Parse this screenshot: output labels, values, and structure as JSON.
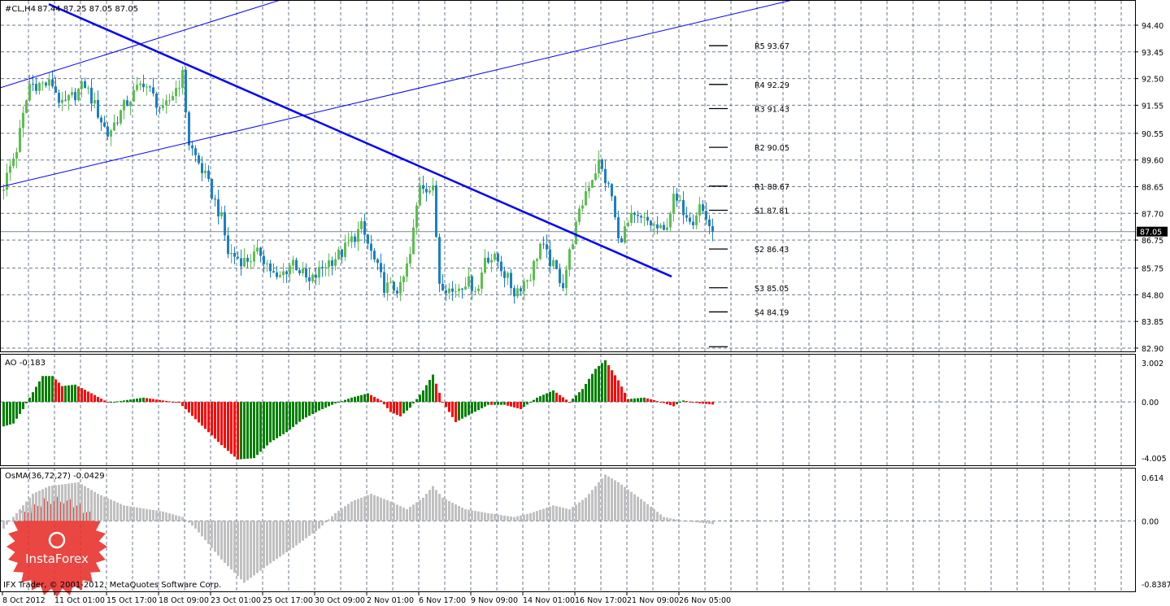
{
  "header": {
    "symbol_label": "#CL,H4",
    "ohlc_label": "87.44 87.25 87.05 87.05"
  },
  "footer": {
    "copyright": "IFX Trader, © 2001-2012, MetaQuotes Software Corp."
  },
  "logo": {
    "text": "InstaForex"
  },
  "colors": {
    "bull": "#5bbf4e",
    "bear": "#1a7fc8",
    "trendline": "#0000ff",
    "ao_up": "#008000",
    "ao_down": "#ff0000",
    "osma": "#c0c0c0",
    "grid": "#6b7a8c"
  },
  "chart_data": [
    {
      "type": "candlestick",
      "title": "#CL,H4",
      "ylim": [
        82.9,
        94.75
      ],
      "y_ticks": [
        "94.40",
        "93.45",
        "92.50",
        "91.55",
        "90.55",
        "89.60",
        "88.65",
        "87.70",
        "86.75",
        "85.75",
        "84.80",
        "83.85",
        "82.90"
      ],
      "current_price": "87.05",
      "bar_count": 219,
      "x_ticks": [
        {
          "bar": 0,
          "label": "8 Oct 2012"
        },
        {
          "bar": 16,
          "label": "11 Oct 01:00"
        },
        {
          "bar": 32,
          "label": "15 Oct 17:00"
        },
        {
          "bar": 48,
          "label": "18 Oct 09:00"
        },
        {
          "bar": 64,
          "label": "23 Oct 01:00"
        },
        {
          "bar": 80,
          "label": "25 Oct 17:00"
        },
        {
          "bar": 96,
          "label": "30 Oct 09:00"
        },
        {
          "bar": 112,
          "label": "2 Nov 01:00"
        },
        {
          "bar": 128,
          "label": "6 Nov 17:00"
        },
        {
          "bar": 144,
          "label": "9 Nov 09:00"
        },
        {
          "bar": 160,
          "label": "14 Nov 01:00"
        },
        {
          "bar": 176,
          "label": "16 Nov 17:00"
        },
        {
          "bar": 192,
          "label": "21 Nov 09:00"
        },
        {
          "bar": 208,
          "label": "26 Nov 05:00"
        }
      ],
      "close_path": [
        [
          0,
          88.7
        ],
        [
          4,
          90.0
        ],
        [
          8,
          92.3
        ],
        [
          15,
          92.3
        ],
        [
          18,
          91.5
        ],
        [
          25,
          92.3
        ],
        [
          32,
          90.5
        ],
        [
          37,
          91.5
        ],
        [
          43,
          92.4
        ],
        [
          49,
          91.3
        ],
        [
          55,
          92.6
        ],
        [
          57,
          90.2
        ],
        [
          62,
          89.0
        ],
        [
          67,
          87.5
        ],
        [
          69,
          86.3
        ],
        [
          74,
          86.0
        ],
        [
          79,
          86.3
        ],
        [
          84,
          85.3
        ],
        [
          89,
          86.0
        ],
        [
          94,
          85.2
        ],
        [
          99,
          85.9
        ],
        [
          104,
          86.3
        ],
        [
          110,
          87.2
        ],
        [
          117,
          85.1
        ],
        [
          122,
          85.0
        ],
        [
          125,
          86.2
        ],
        [
          128,
          88.8
        ],
        [
          132,
          88.5
        ],
        [
          134,
          85.3
        ],
        [
          138,
          84.9
        ],
        [
          142,
          85.3
        ],
        [
          146,
          85.0
        ],
        [
          148,
          86.2
        ],
        [
          152,
          86.0
        ],
        [
          157,
          84.9
        ],
        [
          162,
          85.5
        ],
        [
          165,
          86.6
        ],
        [
          172,
          85.2
        ],
        [
          175,
          86.8
        ],
        [
          179,
          88.5
        ],
        [
          183,
          89.5
        ],
        [
          187,
          88.3
        ],
        [
          189,
          86.7
        ],
        [
          193,
          87.5
        ],
        [
          198,
          87.4
        ],
        [
          203,
          87.0
        ],
        [
          206,
          88.2
        ],
        [
          212,
          87.5
        ],
        [
          214,
          88.0
        ],
        [
          218,
          87.05
        ]
      ],
      "trendlines": [
        {
          "name": "downtrend",
          "from": [
            14.25,
            95.15
          ],
          "to": [
            205.75,
            85.45
          ],
          "thick": true
        },
        {
          "name": "channel-upper",
          "from": [
            -0.75,
            92.17
          ],
          "to": [
            85.5,
            95.3
          ],
          "thick": false
        },
        {
          "name": "channel-lower",
          "from": [
            -0.75,
            88.64
          ],
          "to": [
            243,
            95.3
          ],
          "thick": false
        }
      ],
      "pivots": [
        {
          "label": "R5 93.67",
          "value": 93.67
        },
        {
          "label": "R4 92.29",
          "value": 92.29
        },
        {
          "label": "R3 91.43",
          "value": 91.43
        },
        {
          "label": "R2 90.05",
          "value": 90.05
        },
        {
          "label": "R1 88.67",
          "value": 88.67
        },
        {
          "label": "S1 87.81",
          "value": 87.81
        },
        {
          "label": "S2 86.43",
          "value": 86.43
        },
        {
          "label": "S3 85.05",
          "value": 85.05
        },
        {
          "label": "S4 84.19",
          "value": 84.19
        },
        {
          "label": "",
          "value": 82.95
        }
      ]
    },
    {
      "type": "bar",
      "title": "AO -0.183",
      "ylim": [
        -4.005,
        3.002
      ],
      "y_ticks": [
        "3.002",
        "0.00",
        "-4.005"
      ],
      "path": [
        [
          0,
          -1.7
        ],
        [
          3,
          -1.5
        ],
        [
          6,
          -0.5
        ],
        [
          8,
          0.3
        ],
        [
          12,
          1.8
        ],
        [
          15,
          1.8
        ],
        [
          18,
          1.1
        ],
        [
          22,
          1.2
        ],
        [
          27,
          0.6
        ],
        [
          31,
          0.1
        ],
        [
          32,
          -0.05
        ],
        [
          37,
          0.1
        ],
        [
          43,
          0.3
        ],
        [
          49,
          0.1
        ],
        [
          54,
          -0.05
        ],
        [
          59,
          -1.2
        ],
        [
          67,
          -3.0
        ],
        [
          72,
          -4.0
        ],
        [
          77,
          -3.9
        ],
        [
          82,
          -2.8
        ],
        [
          87,
          -2.1
        ],
        [
          92,
          -1.2
        ],
        [
          97,
          -0.6
        ],
        [
          102,
          -0.1
        ],
        [
          107,
          0.3
        ],
        [
          112,
          0.6
        ],
        [
          116,
          0.1
        ],
        [
          119,
          -0.7
        ],
        [
          122,
          -1.0
        ],
        [
          125,
          -0.4
        ],
        [
          129,
          0.8
        ],
        [
          132,
          1.9
        ],
        [
          135,
          0.0
        ],
        [
          139,
          -1.4
        ],
        [
          144,
          -0.8
        ],
        [
          149,
          -0.2
        ],
        [
          154,
          -0.2
        ],
        [
          159,
          -0.5
        ],
        [
          164,
          0.3
        ],
        [
          169,
          0.8
        ],
        [
          174,
          0.0
        ],
        [
          178,
          0.9
        ],
        [
          182,
          2.3
        ],
        [
          185,
          2.9
        ],
        [
          189,
          1.5
        ],
        [
          192,
          0.2
        ],
        [
          197,
          0.3
        ],
        [
          202,
          0.0
        ],
        [
          206,
          -0.3
        ],
        [
          209,
          0.1
        ],
        [
          214,
          -0.1
        ],
        [
          218,
          -0.183
        ]
      ]
    },
    {
      "type": "bar",
      "title": "OsMA(36,72,27) -0.0429",
      "ylim": [
        -0.8387,
        0.614
      ],
      "y_ticks": [
        "0.614",
        "0.00",
        "-0.8387"
      ],
      "path": [
        [
          0,
          -0.1
        ],
        [
          4,
          0.1
        ],
        [
          9,
          0.35
        ],
        [
          14,
          0.45
        ],
        [
          23,
          0.5
        ],
        [
          29,
          0.35
        ],
        [
          37,
          0.2
        ],
        [
          49,
          0.12
        ],
        [
          55,
          0.05
        ],
        [
          59,
          -0.1
        ],
        [
          67,
          -0.5
        ],
        [
          74,
          -0.8
        ],
        [
          82,
          -0.55
        ],
        [
          89,
          -0.35
        ],
        [
          97,
          -0.1
        ],
        [
          102,
          0.1
        ],
        [
          107,
          0.25
        ],
        [
          113,
          0.35
        ],
        [
          119,
          0.25
        ],
        [
          124,
          0.15
        ],
        [
          129,
          0.3
        ],
        [
          132,
          0.45
        ],
        [
          135,
          0.3
        ],
        [
          142,
          0.15
        ],
        [
          149,
          0.1
        ],
        [
          157,
          0.05
        ],
        [
          162,
          0.1
        ],
        [
          169,
          0.2
        ],
        [
          174,
          0.15
        ],
        [
          179,
          0.3
        ],
        [
          185,
          0.6
        ],
        [
          189,
          0.5
        ],
        [
          197,
          0.25
        ],
        [
          203,
          0.05
        ],
        [
          209,
          0.0
        ],
        [
          218,
          -0.0429
        ]
      ]
    }
  ]
}
